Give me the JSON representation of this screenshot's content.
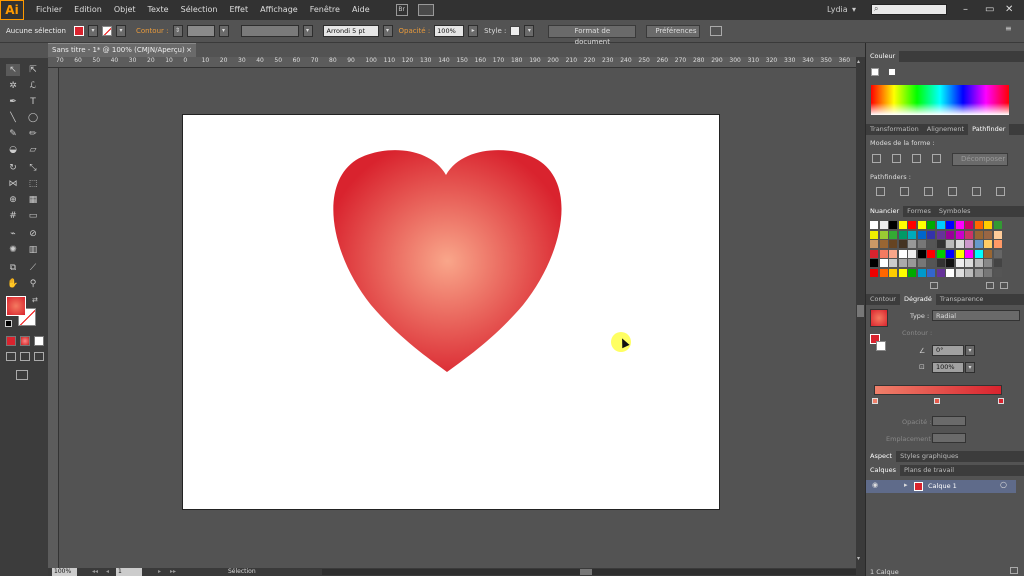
{
  "app": {
    "logo": "Ai",
    "user": "Lydia",
    "user_dropdown": "▾",
    "search_placeholder": ""
  },
  "menu": {
    "items": [
      "Fichier",
      "Edition",
      "Objet",
      "Texte",
      "Sélection",
      "Effet",
      "Affichage",
      "Fenêtre",
      "Aide"
    ]
  },
  "window_controls": {
    "minimize": "–",
    "maximize": "▭",
    "close": "✕"
  },
  "control_bar": {
    "selection_status": "Aucune sélection",
    "contour_label": "Contour :",
    "brush_value": "Arrondi 5 pt",
    "opacity_label": "Opacité :",
    "opacity_value": "100%",
    "style_label": "Style :",
    "doc_format_button": "Format de document",
    "preferences_button": "Préférences"
  },
  "document": {
    "tab_title": "Sans titre - 1* @ 100% (CMJN/Aperçu)",
    "close": "×"
  },
  "ruler": {
    "labels": [
      "70",
      "60",
      "50",
      "40",
      "30",
      "20",
      "10",
      "0",
      "10",
      "20",
      "30",
      "40",
      "50",
      "60",
      "70",
      "80",
      "90",
      "100",
      "110",
      "120",
      "130",
      "140",
      "150",
      "160",
      "170",
      "180",
      "190",
      "200",
      "210",
      "220",
      "230",
      "240",
      "250",
      "260",
      "270",
      "280",
      "290",
      "300",
      "310",
      "320",
      "330",
      "340",
      "350",
      "360"
    ]
  },
  "status": {
    "zoom": "100%",
    "page": "1",
    "tool": "Sélection",
    "first": "◂◂",
    "prev": "◂",
    "next": "▸",
    "last": "▸▸"
  },
  "panels": {
    "couleur": {
      "title": "Couleur"
    },
    "transform_tabs": [
      "Transformation",
      "Alignement",
      "Pathfinder"
    ],
    "pathfinder": {
      "modes_label": "Modes de la forme :",
      "expand_button": "Décomposer",
      "pathfinders_label": "Pathfinders :"
    },
    "swatch_tabs": [
      "Nuancier",
      "Formes",
      "Symboles"
    ],
    "gradient_tabs": [
      "Contour",
      "Dégradé",
      "Transparence"
    ],
    "gradient": {
      "type_label": "Type :",
      "type_value": "Radial",
      "contour_label": "Contour :",
      "angle_value": "0°",
      "ratio_value": "100%",
      "opacity_label": "Opacité :",
      "location_label": "Emplacement :",
      "start_color": "#f0806a",
      "end_color": "#d9232e"
    },
    "aspect_tabs": [
      "Aspect",
      "Styles graphiques"
    ],
    "layer_tabs": [
      "Calques",
      "Plans de travail"
    ],
    "layers": [
      {
        "name": "Calque 1",
        "color": "#d9232e"
      }
    ],
    "layer_count": "1 Calque"
  },
  "artwork": {
    "heart_center_color": "#f9a68a",
    "heart_edge_color": "#d9232e"
  }
}
